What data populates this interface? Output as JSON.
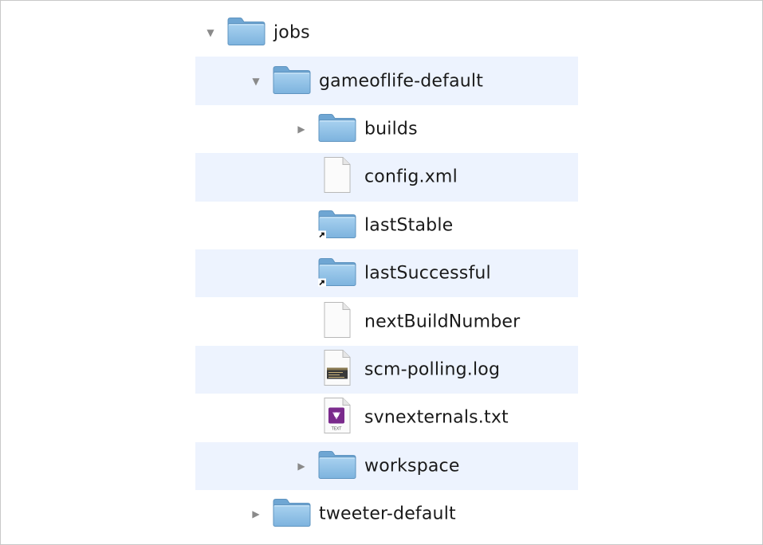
{
  "tree": [
    {
      "label": "jobs",
      "depth": 0,
      "kind": "folder",
      "disclosure": "expanded",
      "alias": false,
      "icon": "folder-icon"
    },
    {
      "label": "gameoflife-default",
      "depth": 1,
      "kind": "folder",
      "disclosure": "expanded",
      "alias": false,
      "icon": "folder-icon"
    },
    {
      "label": "builds",
      "depth": 2,
      "kind": "folder",
      "disclosure": "collapsed",
      "alias": false,
      "icon": "folder-icon"
    },
    {
      "label": "config.xml",
      "depth": 2,
      "kind": "file",
      "disclosure": "none",
      "alias": false,
      "icon": "document-icon"
    },
    {
      "label": "lastStable",
      "depth": 2,
      "kind": "folder",
      "disclosure": "none",
      "alias": true,
      "icon": "folder-alias-icon"
    },
    {
      "label": "lastSuccessful",
      "depth": 2,
      "kind": "folder",
      "disclosure": "none",
      "alias": true,
      "icon": "folder-alias-icon"
    },
    {
      "label": "nextBuildNumber",
      "depth": 2,
      "kind": "file",
      "disclosure": "none",
      "alias": false,
      "icon": "document-icon"
    },
    {
      "label": "scm-polling.log",
      "depth": 2,
      "kind": "log",
      "disclosure": "none",
      "alias": false,
      "icon": "log-file-icon"
    },
    {
      "label": "svnexternals.txt",
      "depth": 2,
      "kind": "text",
      "disclosure": "none",
      "alias": false,
      "icon": "text-file-icon",
      "icon_caption": "TEXT"
    },
    {
      "label": "workspace",
      "depth": 2,
      "kind": "folder",
      "disclosure": "collapsed",
      "alias": false,
      "icon": "folder-icon"
    },
    {
      "label": "tweeter-default",
      "depth": 1,
      "kind": "folder",
      "disclosure": "collapsed",
      "alias": false,
      "icon": "folder-icon"
    }
  ],
  "colors": {
    "row_stripe": "#edf3fe",
    "folder_body": "#8fc0e6",
    "folder_tab": "#7fb3dc",
    "disclosure": "#8a8a8a",
    "text_badge": "#7a2a8c"
  },
  "disclosure_glyphs": {
    "expanded": "▼",
    "collapsed": "▶",
    "none": ""
  }
}
